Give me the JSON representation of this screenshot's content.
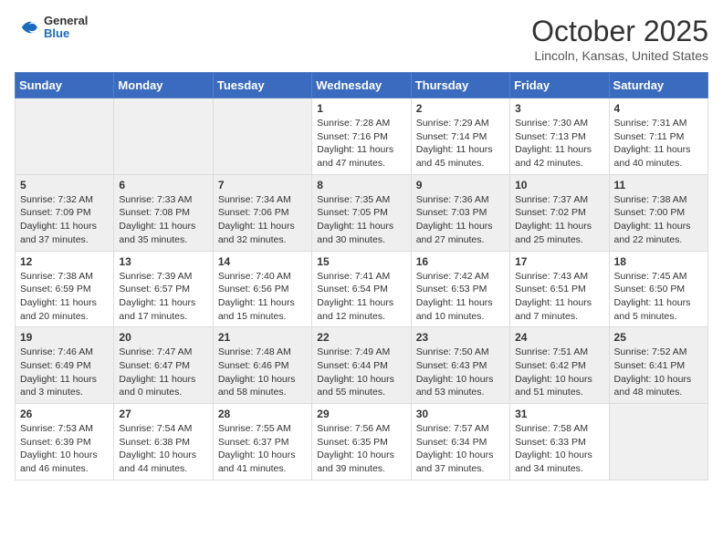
{
  "logo": {
    "general": "General",
    "blue": "Blue"
  },
  "title": "October 2025",
  "location": "Lincoln, Kansas, United States",
  "days_of_week": [
    "Sunday",
    "Monday",
    "Tuesday",
    "Wednesday",
    "Thursday",
    "Friday",
    "Saturday"
  ],
  "weeks": [
    [
      {
        "day": "",
        "content": ""
      },
      {
        "day": "",
        "content": ""
      },
      {
        "day": "",
        "content": ""
      },
      {
        "day": "1",
        "content": "Sunrise: 7:28 AM\nSunset: 7:16 PM\nDaylight: 11 hours\nand 47 minutes."
      },
      {
        "day": "2",
        "content": "Sunrise: 7:29 AM\nSunset: 7:14 PM\nDaylight: 11 hours\nand 45 minutes."
      },
      {
        "day": "3",
        "content": "Sunrise: 7:30 AM\nSunset: 7:13 PM\nDaylight: 11 hours\nand 42 minutes."
      },
      {
        "day": "4",
        "content": "Sunrise: 7:31 AM\nSunset: 7:11 PM\nDaylight: 11 hours\nand 40 minutes."
      }
    ],
    [
      {
        "day": "5",
        "content": "Sunrise: 7:32 AM\nSunset: 7:09 PM\nDaylight: 11 hours\nand 37 minutes."
      },
      {
        "day": "6",
        "content": "Sunrise: 7:33 AM\nSunset: 7:08 PM\nDaylight: 11 hours\nand 35 minutes."
      },
      {
        "day": "7",
        "content": "Sunrise: 7:34 AM\nSunset: 7:06 PM\nDaylight: 11 hours\nand 32 minutes."
      },
      {
        "day": "8",
        "content": "Sunrise: 7:35 AM\nSunset: 7:05 PM\nDaylight: 11 hours\nand 30 minutes."
      },
      {
        "day": "9",
        "content": "Sunrise: 7:36 AM\nSunset: 7:03 PM\nDaylight: 11 hours\nand 27 minutes."
      },
      {
        "day": "10",
        "content": "Sunrise: 7:37 AM\nSunset: 7:02 PM\nDaylight: 11 hours\nand 25 minutes."
      },
      {
        "day": "11",
        "content": "Sunrise: 7:38 AM\nSunset: 7:00 PM\nDaylight: 11 hours\nand 22 minutes."
      }
    ],
    [
      {
        "day": "12",
        "content": "Sunrise: 7:38 AM\nSunset: 6:59 PM\nDaylight: 11 hours\nand 20 minutes."
      },
      {
        "day": "13",
        "content": "Sunrise: 7:39 AM\nSunset: 6:57 PM\nDaylight: 11 hours\nand 17 minutes."
      },
      {
        "day": "14",
        "content": "Sunrise: 7:40 AM\nSunset: 6:56 PM\nDaylight: 11 hours\nand 15 minutes."
      },
      {
        "day": "15",
        "content": "Sunrise: 7:41 AM\nSunset: 6:54 PM\nDaylight: 11 hours\nand 12 minutes."
      },
      {
        "day": "16",
        "content": "Sunrise: 7:42 AM\nSunset: 6:53 PM\nDaylight: 11 hours\nand 10 minutes."
      },
      {
        "day": "17",
        "content": "Sunrise: 7:43 AM\nSunset: 6:51 PM\nDaylight: 11 hours\nand 7 minutes."
      },
      {
        "day": "18",
        "content": "Sunrise: 7:45 AM\nSunset: 6:50 PM\nDaylight: 11 hours\nand 5 minutes."
      }
    ],
    [
      {
        "day": "19",
        "content": "Sunrise: 7:46 AM\nSunset: 6:49 PM\nDaylight: 11 hours\nand 3 minutes."
      },
      {
        "day": "20",
        "content": "Sunrise: 7:47 AM\nSunset: 6:47 PM\nDaylight: 11 hours\nand 0 minutes."
      },
      {
        "day": "21",
        "content": "Sunrise: 7:48 AM\nSunset: 6:46 PM\nDaylight: 10 hours\nand 58 minutes."
      },
      {
        "day": "22",
        "content": "Sunrise: 7:49 AM\nSunset: 6:44 PM\nDaylight: 10 hours\nand 55 minutes."
      },
      {
        "day": "23",
        "content": "Sunrise: 7:50 AM\nSunset: 6:43 PM\nDaylight: 10 hours\nand 53 minutes."
      },
      {
        "day": "24",
        "content": "Sunrise: 7:51 AM\nSunset: 6:42 PM\nDaylight: 10 hours\nand 51 minutes."
      },
      {
        "day": "25",
        "content": "Sunrise: 7:52 AM\nSunset: 6:41 PM\nDaylight: 10 hours\nand 48 minutes."
      }
    ],
    [
      {
        "day": "26",
        "content": "Sunrise: 7:53 AM\nSunset: 6:39 PM\nDaylight: 10 hours\nand 46 minutes."
      },
      {
        "day": "27",
        "content": "Sunrise: 7:54 AM\nSunset: 6:38 PM\nDaylight: 10 hours\nand 44 minutes."
      },
      {
        "day": "28",
        "content": "Sunrise: 7:55 AM\nSunset: 6:37 PM\nDaylight: 10 hours\nand 41 minutes."
      },
      {
        "day": "29",
        "content": "Sunrise: 7:56 AM\nSunset: 6:35 PM\nDaylight: 10 hours\nand 39 minutes."
      },
      {
        "day": "30",
        "content": "Sunrise: 7:57 AM\nSunset: 6:34 PM\nDaylight: 10 hours\nand 37 minutes."
      },
      {
        "day": "31",
        "content": "Sunrise: 7:58 AM\nSunset: 6:33 PM\nDaylight: 10 hours\nand 34 minutes."
      },
      {
        "day": "",
        "content": ""
      }
    ]
  ]
}
